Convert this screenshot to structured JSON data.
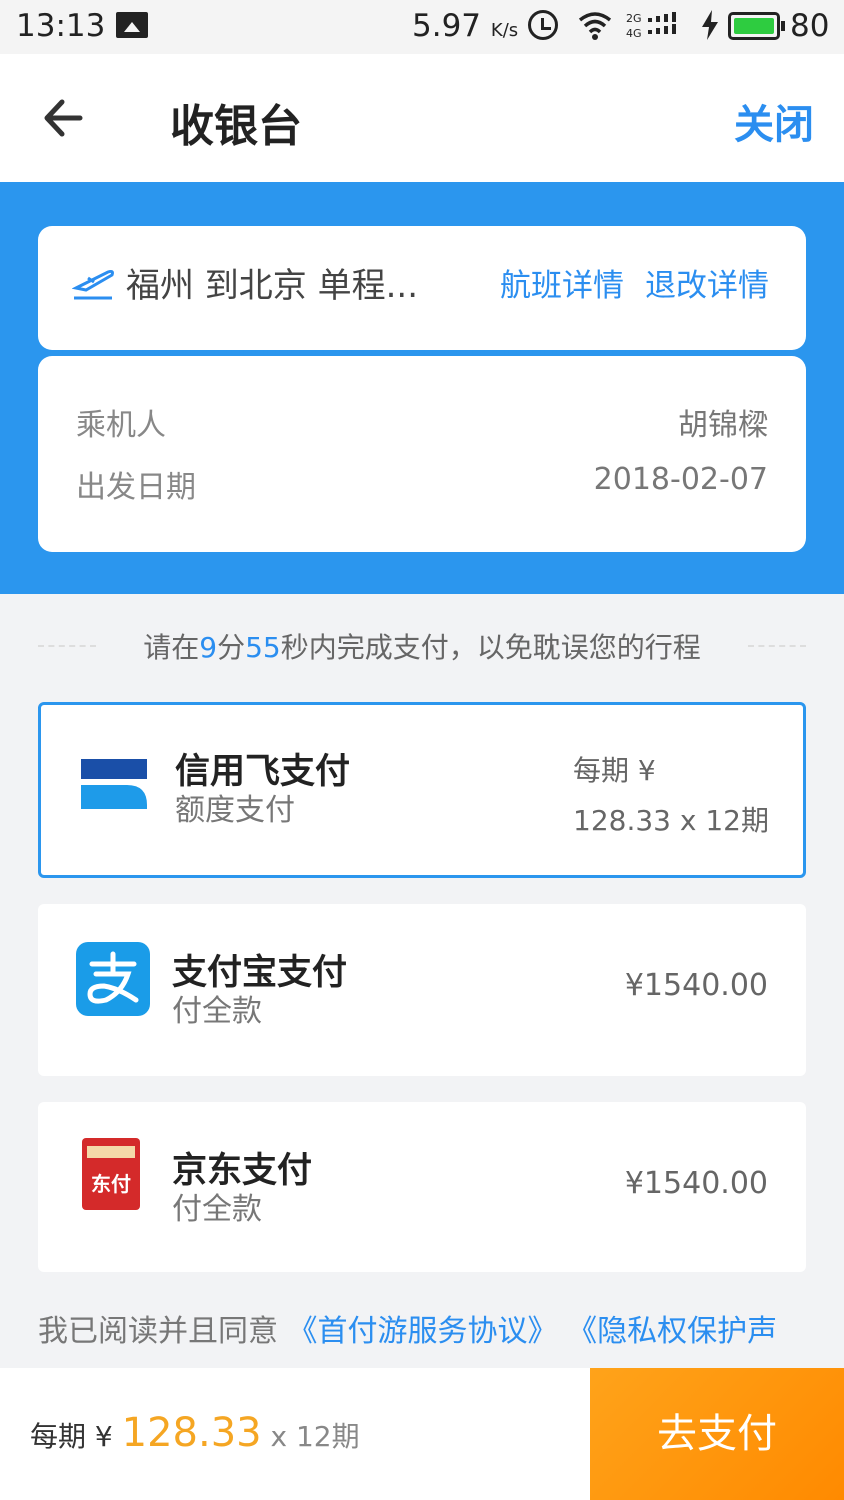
{
  "status_bar": {
    "time": "13:13",
    "speed": "5.97",
    "speed_unit": "K/s",
    "battery": "80"
  },
  "header": {
    "title": "收银台",
    "close_label": "关闭"
  },
  "flight": {
    "route": "福州 到北京 单程...",
    "flight_detail_label": "航班详情",
    "refund_detail_label": "退改详情",
    "passenger_label": "乘机人",
    "passenger_name": "胡锦樑",
    "date_label": "出发日期",
    "date_value": "2018-02-07"
  },
  "countdown": {
    "prefix": "请在",
    "minutes": "9",
    "min_unit": "分",
    "seconds": "55",
    "suffix": "秒内完成支付，以免耽误您的行程"
  },
  "payments": [
    {
      "name": "信用飞支付",
      "sub": "额度支付",
      "per_term_label": "每期 ¥",
      "per_term_value": "128.33 x 12期",
      "selected": true
    },
    {
      "name": "支付宝支付",
      "sub": "付全款",
      "price": "¥1540.00"
    },
    {
      "name": "京东支付",
      "sub": "付全款",
      "price": "¥1540.00",
      "icon_text": "东付"
    }
  ],
  "agreement": {
    "prefix": "我已阅读并且同意",
    "link1": "《首付游服务协议》",
    "link2": "《隐私权保护声"
  },
  "bottom": {
    "per_label": "每期 ¥",
    "amount": "128.33",
    "terms": "x 12期",
    "pay_button": "去支付"
  },
  "colors": {
    "brand_blue": "#2b96ee",
    "link_blue": "#2b8ef0",
    "accent_orange": "#f5a623"
  }
}
